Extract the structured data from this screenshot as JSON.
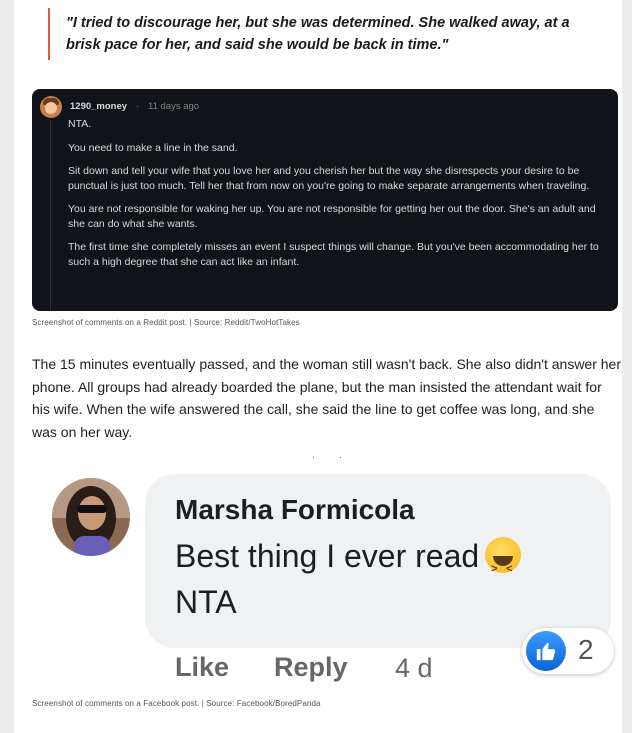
{
  "quote": {
    "text": "\"I tried to discourage her, but she was determined. She walked away, at a brisk pace for her, and said she would be back in time.\""
  },
  "reddit_comment": {
    "username": "1290_money",
    "separator": "·",
    "time": "11 days ago",
    "paragraphs": [
      "NTA.",
      "You need to make a line in the sand.",
      "Sit down and tell your wife that you love her and you cherish her but the way she disrespects your desire to be punctual is just too much. Tell her that from now on you're going to make separate arrangements when traveling.",
      "You are not responsible for waking her up. You are not responsible for getting her out the door. She's an adult and she can do what she wants.",
      "The first time she completely misses an event I suspect things will change. But you've been accommodating her to such a high degree that she can act like an infant."
    ],
    "caption": "Screenshot of comments on a Reddit post. | Source: Reddit/TwoHotTakes"
  },
  "article": {
    "paragraph": "The 15 minutes eventually passed, and the woman still wasn't back. She also didn't answer her phone. All groups had already boarded the plane, but the man insisted the attendant wait for his wife. When the wife answered the call, she said the line to get coffee was long, and she was on her way."
  },
  "facebook_comment": {
    "name": "Marsha Formicola",
    "line1": "Best thing I ever read",
    "line2": "NTA",
    "emoji_icon": "grinning-squinting-face-icon",
    "reaction_icon": "like-icon",
    "reaction_count": "2",
    "like_label": "Like",
    "reply_label": "Reply",
    "time": "4 d",
    "caption": "Screenshot of comments on a Facebook post. | Source: Facebook/BoredPanda"
  },
  "colors": {
    "quote_accent": "#e05a3a",
    "reddit_bg": "#101418",
    "facebook_like_blue": "#0a63d6"
  }
}
